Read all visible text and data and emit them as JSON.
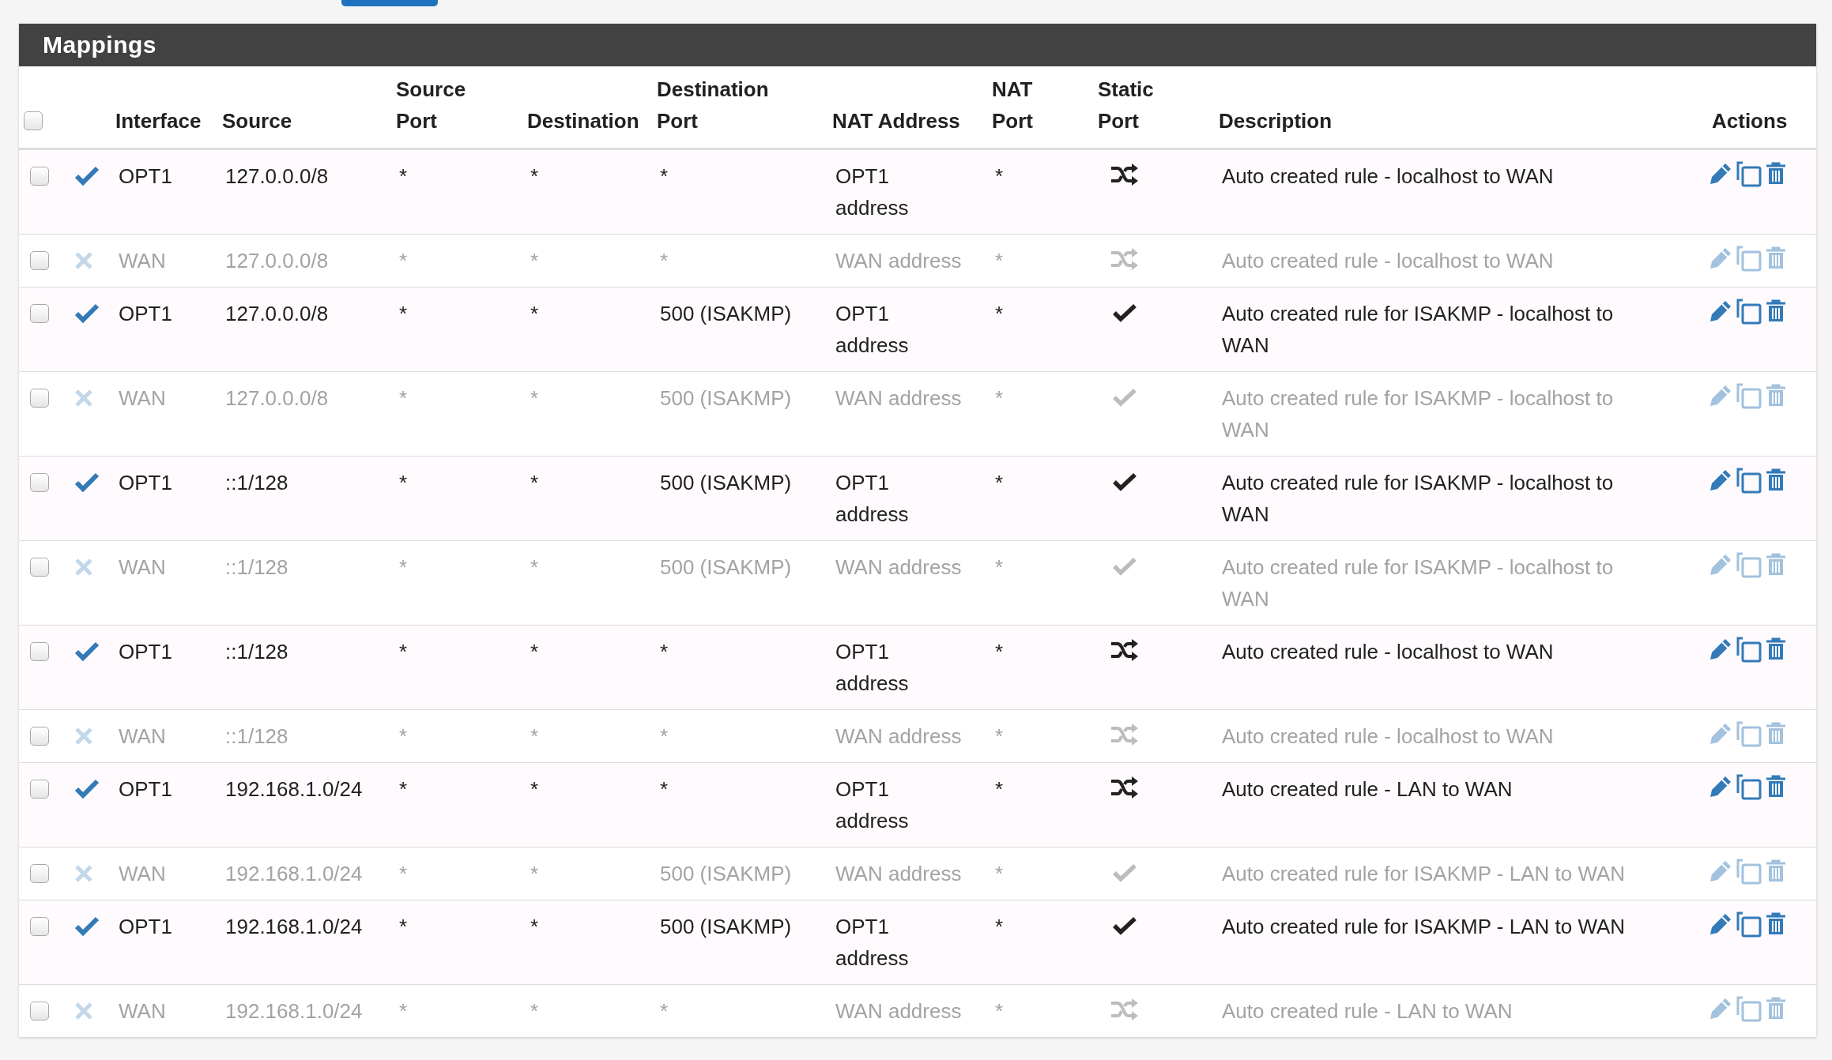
{
  "panel": {
    "title": "Mappings"
  },
  "table": {
    "select_all": {
      "checked": false
    },
    "columns": [
      "Interface",
      "Source",
      "Source Port",
      "Destination",
      "Destination Port",
      "NAT Address",
      "NAT Port",
      "Static Port",
      "Description",
      "Actions"
    ],
    "rows": [
      {
        "checked": false,
        "enabled": true,
        "interface": "OPT1",
        "source": "127.0.0.0/8",
        "source_port": "*",
        "destination": "*",
        "destination_port": "*",
        "nat_address": "OPT1 address",
        "nat_port": "*",
        "static_port": false,
        "description": "Auto created rule - localhost to WAN"
      },
      {
        "checked": false,
        "enabled": false,
        "interface": "WAN",
        "source": "127.0.0.0/8",
        "source_port": "*",
        "destination": "*",
        "destination_port": "*",
        "nat_address": "WAN address",
        "nat_port": "*",
        "static_port": false,
        "description": "Auto created rule - localhost to WAN"
      },
      {
        "checked": false,
        "enabled": true,
        "interface": "OPT1",
        "source": "127.0.0.0/8",
        "source_port": "*",
        "destination": "*",
        "destination_port": "500 (ISAKMP)",
        "nat_address": "OPT1 address",
        "nat_port": "*",
        "static_port": true,
        "description": "Auto created rule for ISAKMP - localhost to WAN"
      },
      {
        "checked": false,
        "enabled": false,
        "interface": "WAN",
        "source": "127.0.0.0/8",
        "source_port": "*",
        "destination": "*",
        "destination_port": "500 (ISAKMP)",
        "nat_address": "WAN address",
        "nat_port": "*",
        "static_port": true,
        "description": "Auto created rule for ISAKMP - localhost to WAN"
      },
      {
        "checked": false,
        "enabled": true,
        "interface": "OPT1",
        "source": "::1/128",
        "source_port": "*",
        "destination": "*",
        "destination_port": "500 (ISAKMP)",
        "nat_address": "OPT1 address",
        "nat_port": "*",
        "static_port": true,
        "description": "Auto created rule for ISAKMP - localhost to WAN"
      },
      {
        "checked": false,
        "enabled": false,
        "interface": "WAN",
        "source": "::1/128",
        "source_port": "*",
        "destination": "*",
        "destination_port": "500 (ISAKMP)",
        "nat_address": "WAN address",
        "nat_port": "*",
        "static_port": true,
        "description": "Auto created rule for ISAKMP - localhost to WAN"
      },
      {
        "checked": false,
        "enabled": true,
        "interface": "OPT1",
        "source": "::1/128",
        "source_port": "*",
        "destination": "*",
        "destination_port": "*",
        "nat_address": "OPT1 address",
        "nat_port": "*",
        "static_port": false,
        "description": "Auto created rule - localhost to WAN"
      },
      {
        "checked": false,
        "enabled": false,
        "interface": "WAN",
        "source": "::1/128",
        "source_port": "*",
        "destination": "*",
        "destination_port": "*",
        "nat_address": "WAN address",
        "nat_port": "*",
        "static_port": false,
        "description": "Auto created rule - localhost to WAN"
      },
      {
        "checked": false,
        "enabled": true,
        "interface": "OPT1",
        "source": "192.168.1.0/24",
        "source_port": "*",
        "destination": "*",
        "destination_port": "*",
        "nat_address": "OPT1 address",
        "nat_port": "*",
        "static_port": false,
        "description": "Auto created rule - LAN to WAN"
      },
      {
        "checked": false,
        "enabled": false,
        "interface": "WAN",
        "source": "192.168.1.0/24",
        "source_port": "*",
        "destination": "*",
        "destination_port": "500 (ISAKMP)",
        "nat_address": "WAN address",
        "nat_port": "*",
        "static_port": true,
        "description": "Auto created rule for ISAKMP - LAN to WAN"
      },
      {
        "checked": false,
        "enabled": true,
        "interface": "OPT1",
        "source": "192.168.1.0/24",
        "source_port": "*",
        "destination": "*",
        "destination_port": "500 (ISAKMP)",
        "nat_address": "OPT1 address",
        "nat_port": "*",
        "static_port": true,
        "description": "Auto created rule for ISAKMP - LAN to WAN"
      },
      {
        "checked": false,
        "enabled": false,
        "interface": "WAN",
        "source": "192.168.1.0/24",
        "source_port": "*",
        "destination": "*",
        "destination_port": "*",
        "nat_address": "WAN address",
        "nat_port": "*",
        "static_port": false,
        "description": "Auto created rule - LAN to WAN"
      }
    ]
  }
}
